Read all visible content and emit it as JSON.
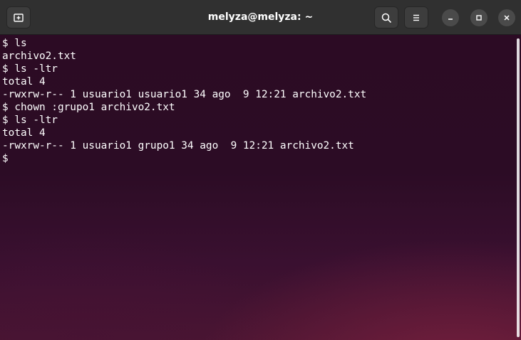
{
  "window": {
    "title": "melyza@melyza: ~"
  },
  "titlebar": {
    "new_tab_icon": "new-tab-icon",
    "search_icon": "search-icon",
    "menu_icon": "hamburger-menu-icon",
    "minimize_icon": "minimize-icon",
    "maximize_icon": "maximize-icon",
    "close_icon": "close-icon"
  },
  "terminal": {
    "lines": [
      "$ ls",
      "archivo2.txt",
      "$ ls -ltr",
      "total 4",
      "-rwxrw-r-- 1 usuario1 usuario1 34 ago  9 12:21 archivo2.txt",
      "$ chown :grupo1 archivo2.txt",
      "$ ls -ltr",
      "total 4",
      "-rwxrw-r-- 1 usuario1 grupo1 34 ago  9 12:21 archivo2.txt",
      "$"
    ]
  },
  "colors": {
    "titlebar_bg": "#303030",
    "terminal_bg": "#2c0b24",
    "text": "#ffffff"
  }
}
